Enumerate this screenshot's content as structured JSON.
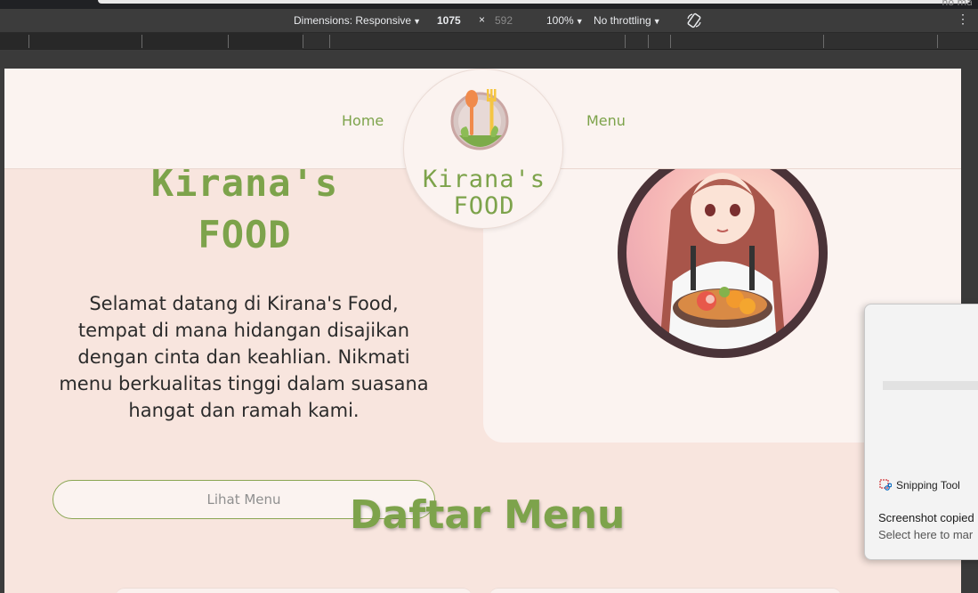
{
  "devtools": {
    "corner_text": "no ma",
    "dimensions_label": "Dimensions: Responsive",
    "width_value": "1075",
    "times_symbol": "×",
    "height_value": "592",
    "zoom": "100%",
    "throttling": "No throttling"
  },
  "site": {
    "nav": {
      "home": "Home",
      "menu": "Menu"
    },
    "logo": {
      "line1": "Kirana's",
      "line2": "FOOD"
    },
    "hero": {
      "title_line1": "Kirana's",
      "title_line2": "FOOD",
      "description": "Selamat datang di Kirana's Food, tempat di mana hidangan disajikan dengan cinta dan keahlian. Nikmati menu berkualitas tinggi dalam suasana hangat dan ramah kami.",
      "button": "Lihat Menu"
    },
    "section_title": "Daftar Menu"
  },
  "toast": {
    "app_name": "Snipping Tool",
    "message": "Screenshot copied",
    "sub": "Select here to mar"
  },
  "colors": {
    "accent_green": "#7da34b",
    "page_bg": "#f8e5de",
    "card_bg": "#fbf3f0"
  }
}
